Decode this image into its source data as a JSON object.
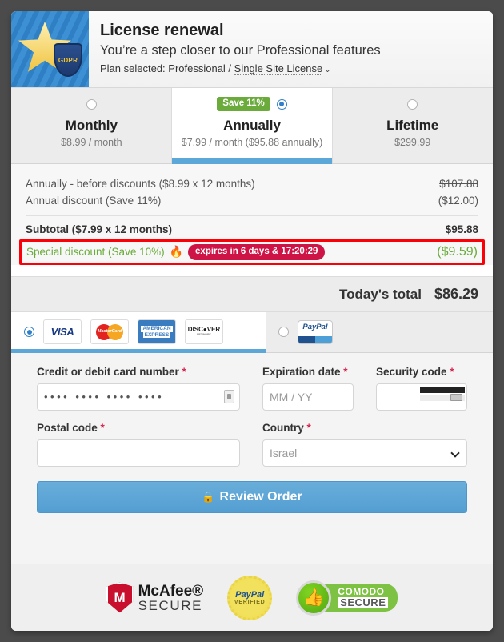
{
  "header": {
    "title": "License renewal",
    "subtitle": "You’re a step closer to our Professional features",
    "plan_prefix": "Plan selected: Professional / ",
    "plan_link": "Single Site License",
    "chevron": "⌄",
    "logo_badge": "GDPR"
  },
  "plans": [
    {
      "name": "Monthly",
      "price": "$8.99 / month",
      "badge": "",
      "selected": false
    },
    {
      "name": "Annually",
      "price": "$7.99 / month ($95.88 annually)",
      "badge": "Save 11%",
      "selected": true
    },
    {
      "name": "Lifetime",
      "price": "$299.99",
      "badge": "",
      "selected": false
    }
  ],
  "breakdown": {
    "rows": [
      {
        "label": "Annually - before discounts ($8.99 x 12 months)",
        "value": "$107.88",
        "style": "strike"
      },
      {
        "label": "Annual discount (Save 11%)",
        "value": "($12.00)",
        "style": "green"
      }
    ],
    "subtotal_label": "Subtotal ($7.99 x 12 months)",
    "subtotal_value": "$95.88",
    "special_label": "Special discount (Save 10%)",
    "special_fire": "🔥",
    "special_timer": "expires in 6 days & 17:20:29",
    "special_value": "($9.59)",
    "total_label": "Today's total",
    "total_value": "$86.29"
  },
  "payment_methods": {
    "credit_selected": true,
    "paypal_selected": false,
    "cards": [
      "VISA",
      "MasterCard",
      "AMERICAN EXPRESS",
      "DISCOVER"
    ],
    "amex_line1": "AMERICAN",
    "amex_line2": "EXPRESS",
    "discover_main": "DISC●VER",
    "discover_sub": "NETWORK",
    "paypal_label": "PayPal"
  },
  "form": {
    "card_number_label": "Credit or debit card number",
    "card_number_value": "••••  ••••  ••••  ••••",
    "expiration_label": "Expiration date",
    "expiration_placeholder": "MM / YY",
    "expiration_value": "",
    "security_label": "Security code",
    "security_value": "",
    "postal_label": "Postal code",
    "postal_value": "",
    "country_label": "Country",
    "country_value": "Israel",
    "required_mark": "*",
    "submit_label": "Review Order",
    "submit_lock": "🔒"
  },
  "footer": {
    "mcafee_initial": "M",
    "mcafee_line1": "McAfee®",
    "mcafee_line2": "SECURE",
    "paypal_line1": "PayPal",
    "paypal_line2": "VERIFIED",
    "comodo_thumb": "👍",
    "comodo_line1": "COMODO",
    "comodo_line2": "SECURE"
  },
  "colors": {
    "accent_blue": "#5ba7d8",
    "green": "#6aab3c",
    "crimson": "#ce1446",
    "alert_red": "#fb0007",
    "required": "#d6224c"
  }
}
